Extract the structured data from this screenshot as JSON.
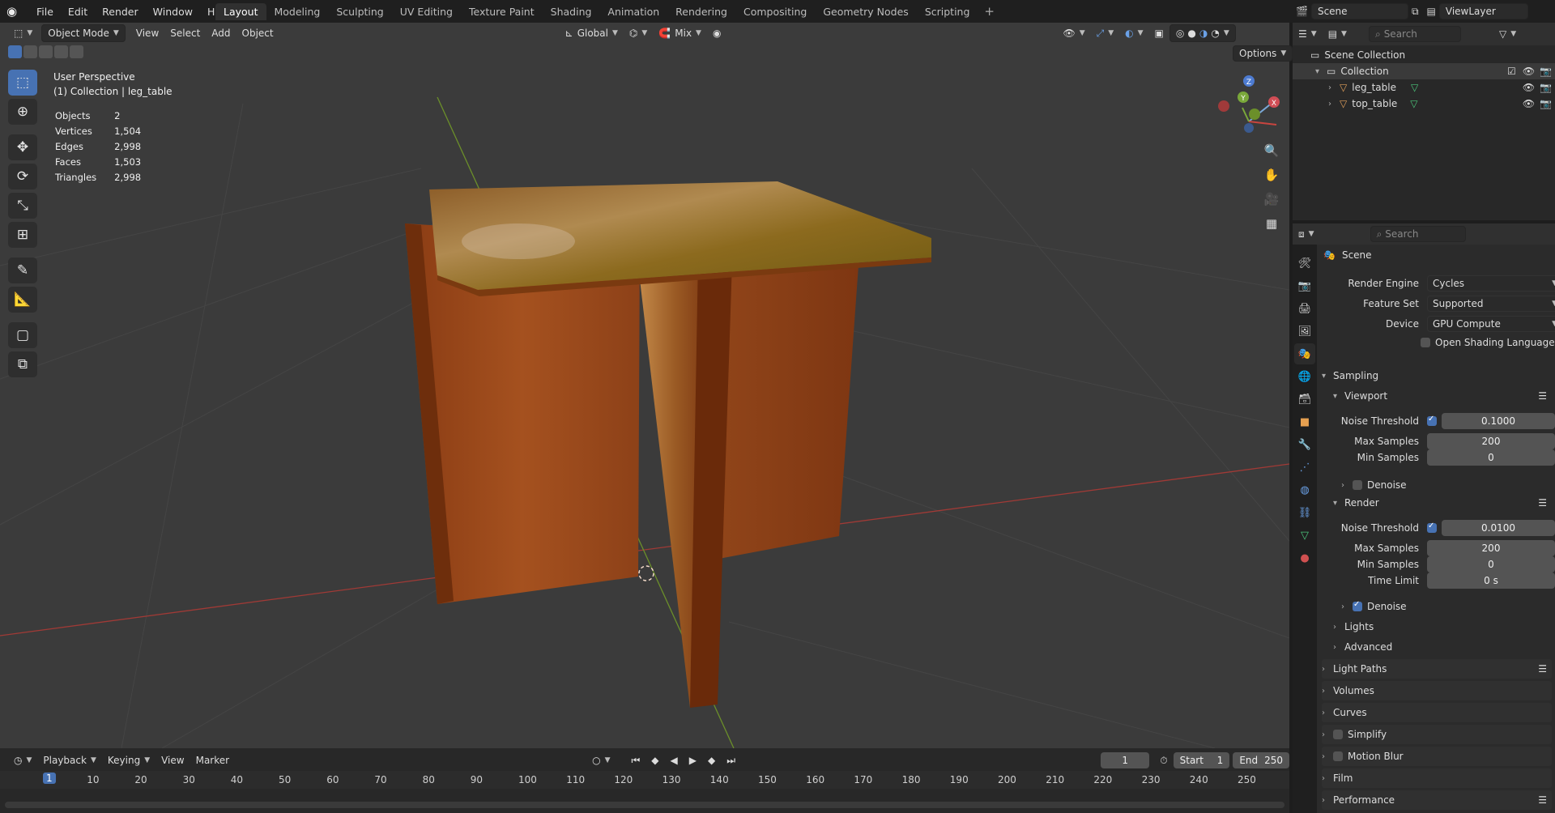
{
  "menu": [
    "File",
    "Edit",
    "Render",
    "Window",
    "Help"
  ],
  "workspaces": [
    "Layout",
    "Modeling",
    "Sculpting",
    "UV Editing",
    "Texture Paint",
    "Shading",
    "Animation",
    "Rendering",
    "Compositing",
    "Geometry Nodes",
    "Scripting"
  ],
  "active_workspace": "Layout",
  "viewport_header": {
    "mode": "Object Mode",
    "menus": [
      "View",
      "Select",
      "Add",
      "Object"
    ],
    "transform_orientation": "Global",
    "snap": "Mix",
    "options": "Options"
  },
  "overlay": {
    "perspective": "User Perspective",
    "collection_info": "(1) Collection | leg_table"
  },
  "stats": [
    {
      "label": "Objects",
      "value": "2"
    },
    {
      "label": "Vertices",
      "value": "1,504"
    },
    {
      "label": "Edges",
      "value": "2,998"
    },
    {
      "label": "Faces",
      "value": "1,503"
    },
    {
      "label": "Triangles",
      "value": "2,998"
    }
  ],
  "gizmo": {
    "x": "X",
    "y": "Y",
    "z": "Z"
  },
  "outliner": {
    "scene": "Scene",
    "view_layer": "ViewLayer",
    "search_placeholder": "Search",
    "scene_collection": "Scene Collection",
    "collection": "Collection",
    "objects": [
      "leg_table",
      "top_table"
    ]
  },
  "properties": {
    "search_placeholder": "Search",
    "context": "Scene",
    "render_engine_label": "Render Engine",
    "render_engine": "Cycles",
    "feature_set_label": "Feature Set",
    "feature_set": "Supported",
    "device_label": "Device",
    "device": "GPU Compute",
    "osl": "Open Shading Language",
    "sampling": "Sampling",
    "viewport": "Viewport",
    "noise_threshold_label": "Noise Threshold",
    "vp_noise_threshold": "0.1000",
    "max_samples_label": "Max Samples",
    "vp_max_samples": "200",
    "min_samples_label": "Min Samples",
    "vp_min_samples": "0",
    "denoise": "Denoise",
    "render": "Render",
    "r_noise_threshold": "0.0100",
    "r_max_samples": "200",
    "r_min_samples": "0",
    "time_limit_label": "Time Limit",
    "r_time_limit": "0 s",
    "lights": "Lights",
    "advanced": "Advanced",
    "light_paths": "Light Paths",
    "volumes": "Volumes",
    "curves": "Curves",
    "simplify": "Simplify",
    "motion_blur": "Motion Blur",
    "film": "Film",
    "performance": "Performance"
  },
  "timeline": {
    "menus": [
      "Playback",
      "Keying",
      "View",
      "Marker"
    ],
    "current_frame": "1",
    "start_label": "Start",
    "start": "1",
    "end_label": "End",
    "end": "250",
    "ticks": [
      "1",
      "10",
      "20",
      "30",
      "40",
      "50",
      "60",
      "70",
      "80",
      "90",
      "100",
      "110",
      "120",
      "130",
      "140",
      "150",
      "160",
      "170",
      "180",
      "190",
      "200",
      "210",
      "220",
      "230",
      "240",
      "250"
    ]
  },
  "colors": {
    "accent": "#4772b3",
    "x_axis": "#c8453f",
    "y_axis": "#7aa83a",
    "wood": "#9c4a1c"
  }
}
